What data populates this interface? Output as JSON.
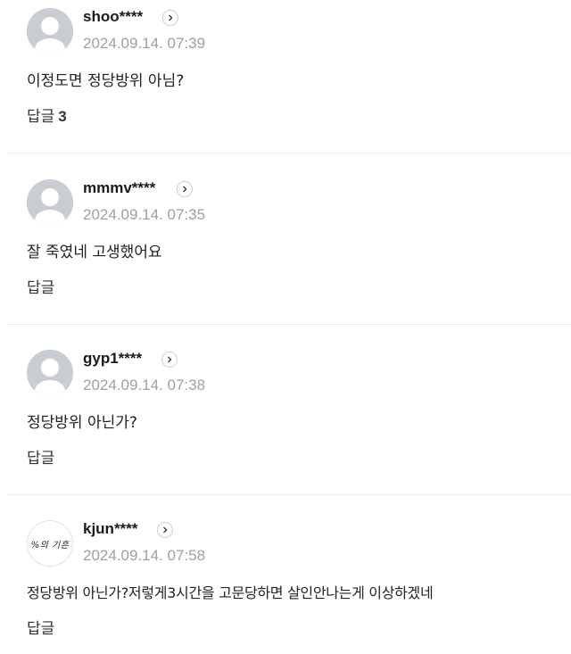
{
  "comments": [
    {
      "nickname": "shoo****",
      "date": "2024.09.14. 07:39",
      "text": "이정도면 정당방위 아님?",
      "reply_label": "답글",
      "reply_count": "3",
      "avatar": "default-avatar"
    },
    {
      "nickname": "mmmv****",
      "date": "2024.09.14. 07:35",
      "text": "잘 죽였네 고생했어요",
      "reply_label": "답글",
      "reply_count": "",
      "avatar": "default-avatar"
    },
    {
      "nickname": "gyp1****",
      "date": "2024.09.14. 07:38",
      "text": "정당방위 아닌가?",
      "reply_label": "답글",
      "reply_count": "",
      "avatar": "default-avatar"
    },
    {
      "nickname": "kjun****",
      "date": "2024.09.14. 07:58",
      "text": "정당방위 아닌가?저렇게3시간을 고문당하면 살인안나는게 이상하겠네",
      "reply_label": "답글",
      "reply_count": "",
      "avatar": "custom-avatar",
      "avatar_text": "%의 기흔"
    }
  ],
  "icons": {
    "more": "chevron-right-icon",
    "avatar": "user-silhouette-icon"
  },
  "colors": {
    "date": "#a0a0a0",
    "divider": "#ececec",
    "avatar_bg": "#c9ced4"
  }
}
